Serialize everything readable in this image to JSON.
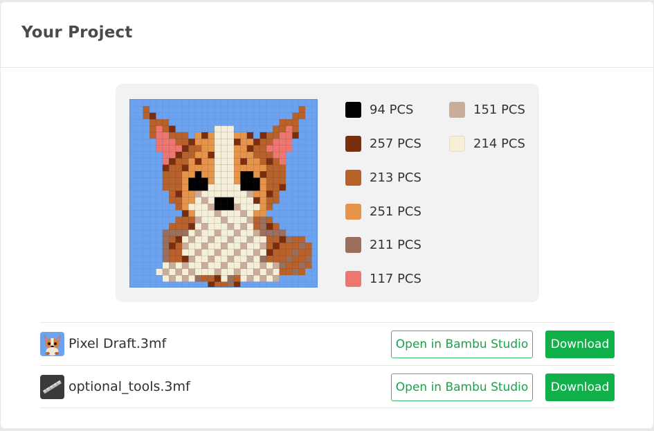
{
  "project": {
    "title": "Your Project"
  },
  "palette": {
    "swatches": [
      {
        "color": "#000000",
        "label": "94 PCS"
      },
      {
        "color": "#7a2e0e",
        "label": "257 PCS"
      },
      {
        "color": "#b8612a",
        "label": "213 PCS"
      },
      {
        "color": "#e6944a",
        "label": "251 PCS"
      },
      {
        "color": "#9a6f5c",
        "label": "211 PCS"
      },
      {
        "color": "#ee7670",
        "label": "117 PCS"
      },
      {
        "color": "#c9ad9a",
        "label": "151 PCS"
      },
      {
        "color": "#f6efd8",
        "label": "214 PCS"
      }
    ],
    "background_color": "#6ca2ee"
  },
  "files": [
    {
      "name": "Pixel Draft.3mf",
      "thumb_icon": "corgi-thumbnail-icon",
      "open_label": "Open in Bambu Studio",
      "download_label": "Download"
    },
    {
      "name": "optional_tools.3mf",
      "thumb_icon": "tool-thumbnail-icon",
      "open_label": "Open in Bambu Studio",
      "download_label": "Download"
    }
  ]
}
